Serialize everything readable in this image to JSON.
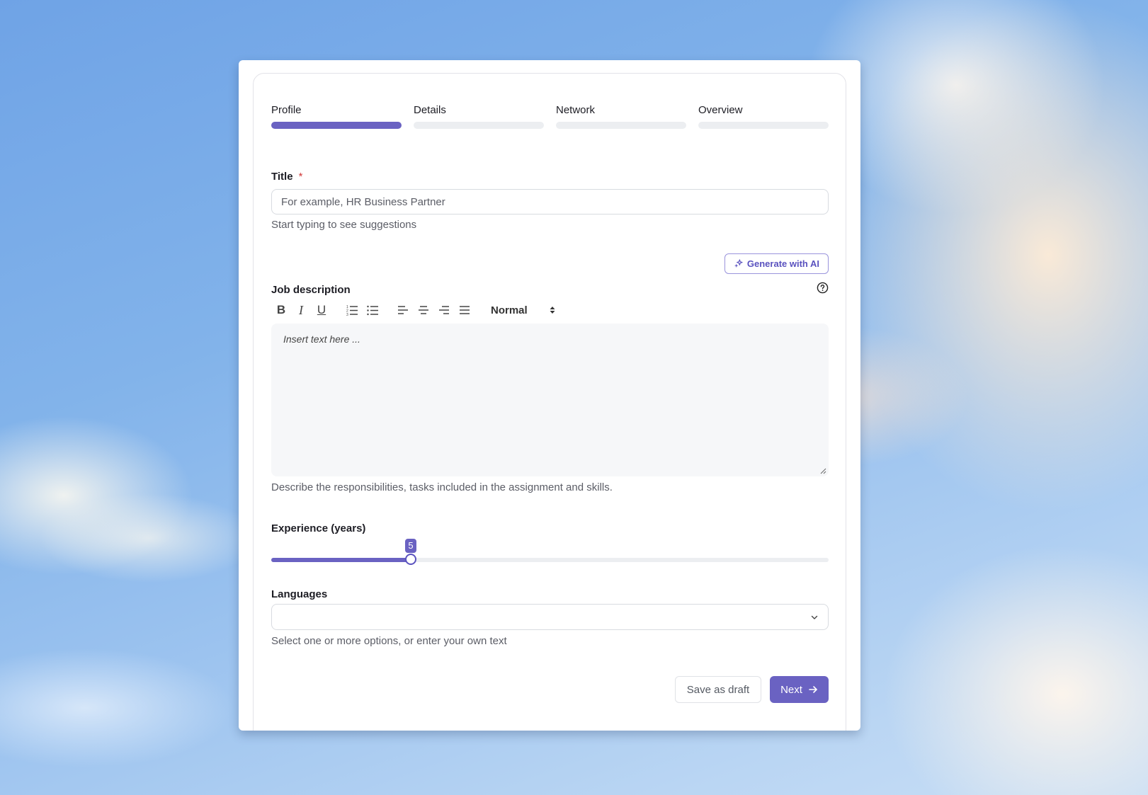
{
  "steps": [
    {
      "label": "Profile",
      "active": true
    },
    {
      "label": "Details",
      "active": false
    },
    {
      "label": "Network",
      "active": false
    },
    {
      "label": "Overview",
      "active": false
    }
  ],
  "title_field": {
    "label": "Title",
    "required_mark": "*",
    "placeholder": "For example, HR Business Partner",
    "value": "",
    "hint": "Start typing to see suggestions"
  },
  "ai_button": {
    "label": "Generate with AI",
    "icon": "sparkle-icon"
  },
  "job_description": {
    "label": "Job description",
    "help_icon": "help-circle-icon",
    "toolbar": {
      "bold": "B",
      "italic": "I",
      "underline": "U",
      "format_select": "Normal"
    },
    "placeholder": "Insert text here ...",
    "hint": "Describe the responsibilities, tasks included in the assignment and skills."
  },
  "experience": {
    "label": "Experience (years)",
    "value": 5,
    "fraction": 0.25
  },
  "languages": {
    "label": "Languages",
    "value": "",
    "hint": "Select one or more options, or enter your own text"
  },
  "actions": {
    "save_draft": "Save as draft",
    "next": "Next"
  },
  "colors": {
    "accent": "#6a62c2",
    "required": "#d23b3b",
    "track": "#eceef1"
  }
}
